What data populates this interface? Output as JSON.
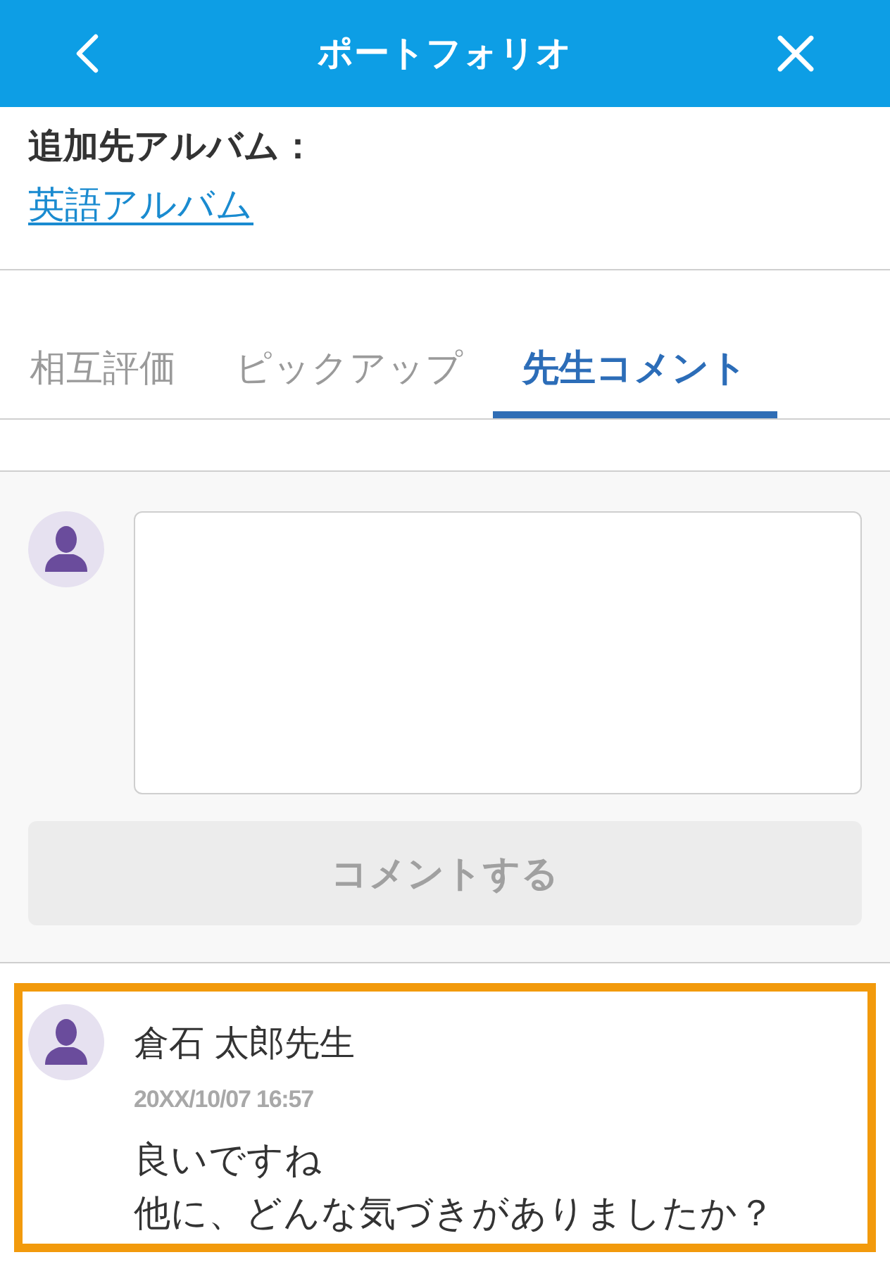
{
  "header": {
    "title": "ポートフォリオ"
  },
  "album": {
    "label": "追加先アルバム：",
    "link": "英語アルバム"
  },
  "tabs": [
    {
      "label": "相互評価",
      "selected": false
    },
    {
      "label": "ピックアップ",
      "selected": false
    },
    {
      "label": "先生コメント",
      "selected": true
    }
  ],
  "comment_form": {
    "submit": {
      "label": "コメントする",
      "disabled": true
    }
  },
  "comments": [
    {
      "author": "倉石 太郎先生",
      "time": "20XX/10/07 16:57",
      "lines": [
        "良いですね",
        "他に、どんな気づきがありましたか？"
      ],
      "highlighted": true
    }
  ]
}
